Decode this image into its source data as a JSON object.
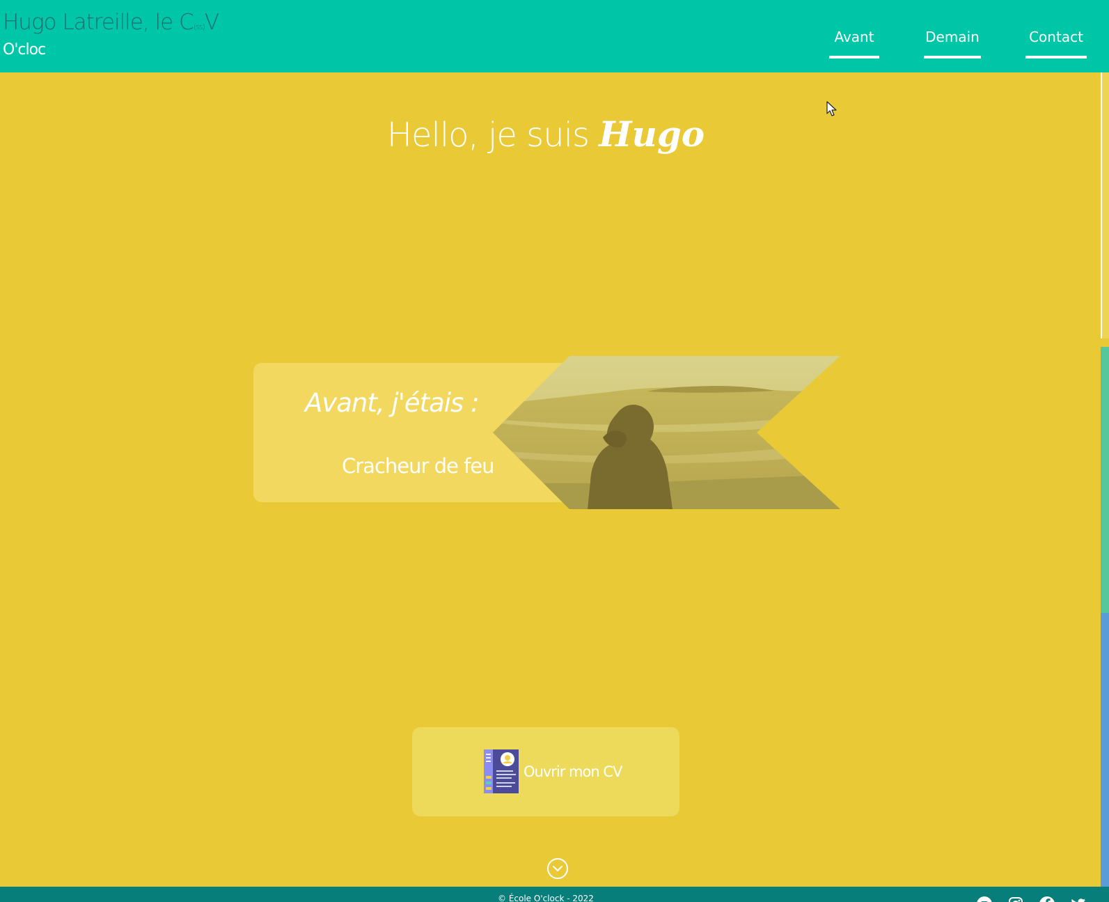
{
  "header": {
    "title": {
      "prefix": "Hugo Latreille, le C",
      "small": "(ss)",
      "suffix": "V"
    },
    "subtitle": "O'cloc",
    "nav": [
      {
        "label": "Avant"
      },
      {
        "label": "Demain"
      },
      {
        "label": "Contact"
      }
    ]
  },
  "hero": {
    "prefix": "Hello, je suis ",
    "name": "Hugo"
  },
  "intro_card": {
    "heading": "Avant, j'étais :",
    "job": "Cracheur de feu",
    "image_icon": "beach-photo"
  },
  "cv_button": {
    "label": "Ouvrir mon CV",
    "icon": "cv-document-icon"
  },
  "scroll_button": {
    "icon": "chevron-down-circle-icon"
  },
  "footer": {
    "copyright": "© École O'clock - 2022",
    "social_icons": [
      "email-icon",
      "instagram-icon",
      "facebook-icon",
      "twitter-icon"
    ]
  },
  "colors": {
    "header": "#00c6a8",
    "page": "#e9c935",
    "footer": "#087e7a",
    "accent_green": "#56c79a",
    "accent_blue": "#5a9cd7"
  }
}
